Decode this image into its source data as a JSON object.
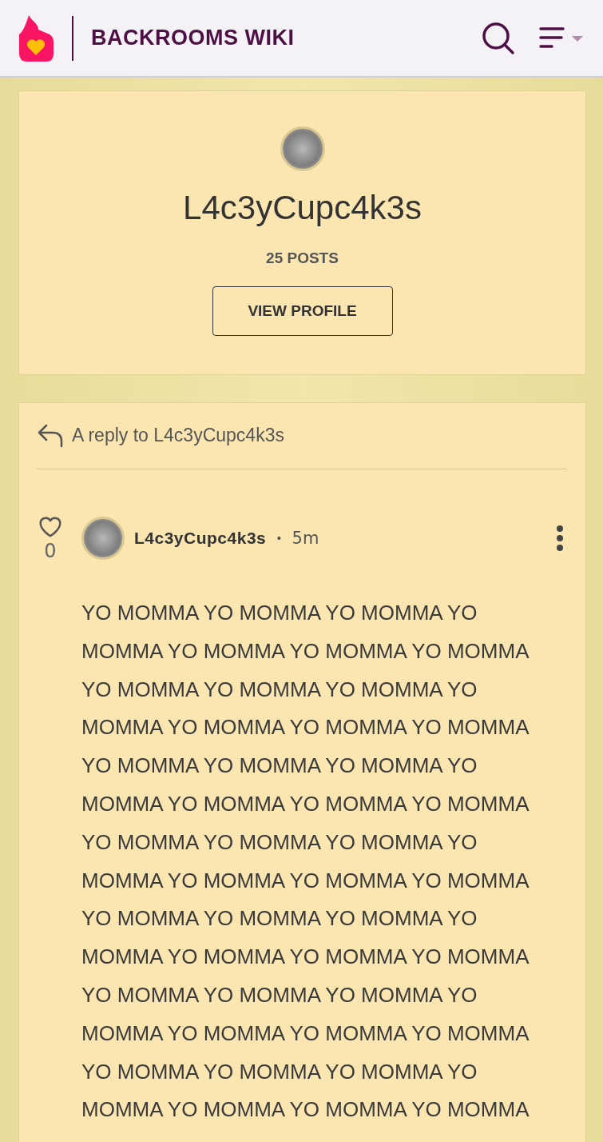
{
  "header": {
    "title": "BACKROOMS WIKI"
  },
  "profile": {
    "username": "L4c3yCupc4k3s",
    "posts": "25 POSTS",
    "button": "VIEW PROFILE"
  },
  "thread": {
    "reply_to": "A reply to L4c3yCupc4k3s",
    "post": {
      "likes": "0",
      "liked": false,
      "author": "L4c3yCupc4k3s",
      "separator": "•",
      "time": "5m",
      "body": "YO MOMMA YO MOMMA YO MOMMA YO MOMMA YO MOMMA YO MOMMA YO MOMMA YO MOMMA YO MOMMA YO MOMMA YO MOMMA YO MOMMA YO MOMMA YO MOMMA YO MOMMA YO MOMMA YO MOMMA YO MOMMA YO MOMMA YO MOMMA YO MOMMA YO MOMMA YO MOMMA YO MOMMA YO MOMMA YO MOMMA YO MOMMA YO MOMMA YO MOMMA YO MOMMA YO MOMMA YO MOMMA YO MOMMA YO MOMMA YO MOMMA YO MOMMA YO MOMMA YO MOMMA YO MOMMA YO MOMMA YO MOMMA YO MOMMA YO MOMMA YO MOMMA YO MOMMA YO MOMMA YO MOMMA YO MOMMA YO MOMMA"
    }
  }
}
